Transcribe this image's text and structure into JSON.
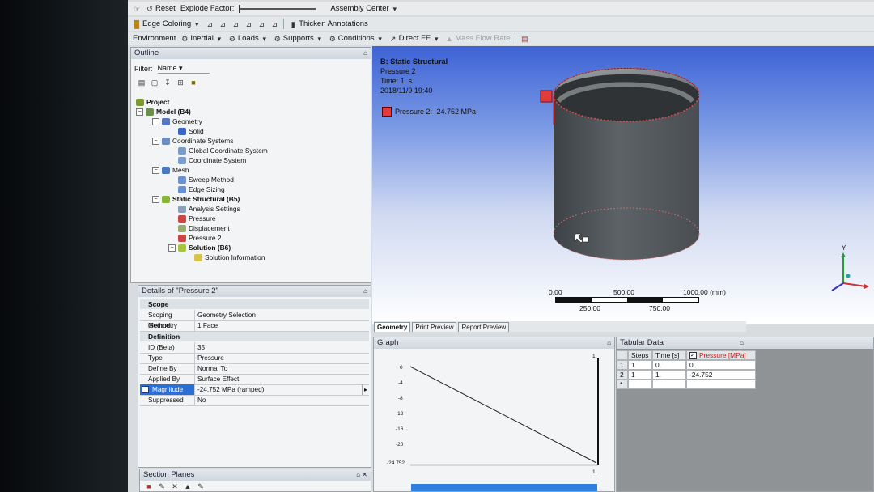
{
  "toolbar1": {
    "reset_label": "Reset",
    "explode_label": "Explode Factor:",
    "assembly_center": "Assembly Center"
  },
  "toolbar2": {
    "edge_coloring": "Edge Coloring",
    "thicken": "Thicken Annotations"
  },
  "toolbar3": {
    "environment": "Environment",
    "inertial": "Inertial",
    "loads": "Loads",
    "supports": "Supports",
    "conditions": "Conditions",
    "direct_fe": "Direct FE",
    "mass_flow": "Mass Flow Rate"
  },
  "outline": {
    "title": "Outline",
    "filter_label": "Filter:",
    "filter_value": "Name",
    "items": [
      {
        "label": "Project",
        "bold": true
      },
      {
        "label": "Model (B4)",
        "bold": true
      },
      {
        "label": "Geometry"
      },
      {
        "label": "Solid"
      },
      {
        "label": "Coordinate Systems"
      },
      {
        "label": "Global Coordinate System"
      },
      {
        "label": "Coordinate System"
      },
      {
        "label": "Mesh"
      },
      {
        "label": "Sweep Method"
      },
      {
        "label": "Edge Sizing"
      },
      {
        "label": "Static Structural (B5)",
        "bold": true
      },
      {
        "label": "Analysis Settings"
      },
      {
        "label": "Pressure"
      },
      {
        "label": "Displacement"
      },
      {
        "label": "Pressure 2"
      },
      {
        "label": "Solution (B6)",
        "bold": true
      },
      {
        "label": "Solution Information"
      }
    ]
  },
  "details": {
    "title": "Details of \"Pressure 2\"",
    "scope_label": "Scope",
    "definition_label": "Definition",
    "rows": [
      {
        "k": "Scoping Method",
        "v": "Geometry Selection"
      },
      {
        "k": "Geometry",
        "v": "1 Face"
      },
      {
        "k": "ID (Beta)",
        "v": "35"
      },
      {
        "k": "Type",
        "v": "Pressure"
      },
      {
        "k": "Define By",
        "v": "Normal To"
      },
      {
        "k": "Applied By",
        "v": "Surface Effect"
      },
      {
        "k": "Magnitude",
        "v": "-24.752 MPa  (ramped)"
      },
      {
        "k": "Suppressed",
        "v": "No"
      }
    ]
  },
  "viewport": {
    "title": "B: Static Structural",
    "subtitle": "Pressure 2",
    "time": "Time: 1. s",
    "date": "2018/11/9 19:40",
    "legend": "Pressure 2: -24.752 MPa",
    "legend_color": "#e23b3b",
    "scale_top": [
      "0.00",
      "500.00",
      "1000.00 (mm)"
    ],
    "scale_bottom": [
      "250.00",
      "750.00"
    ],
    "axis_y": "Y"
  },
  "view_tabs": [
    "Geometry",
    "Print Preview",
    "Report Preview"
  ],
  "graph": {
    "title": "Graph",
    "y_ticks": [
      "0",
      "-4",
      "-8",
      "-12",
      "-16",
      "-20",
      "-24.752"
    ],
    "x_end": "1."
  },
  "tabular": {
    "title": "Tabular Data",
    "headers": [
      "Steps",
      "Time [s]",
      "Pressure [MPa]"
    ],
    "rows": [
      [
        "1",
        "1",
        "0.",
        "0."
      ],
      [
        "2",
        "1",
        "1.",
        "-24.752"
      ]
    ],
    "new_row": "*"
  },
  "section_planes": {
    "title": "Section Planes"
  }
}
